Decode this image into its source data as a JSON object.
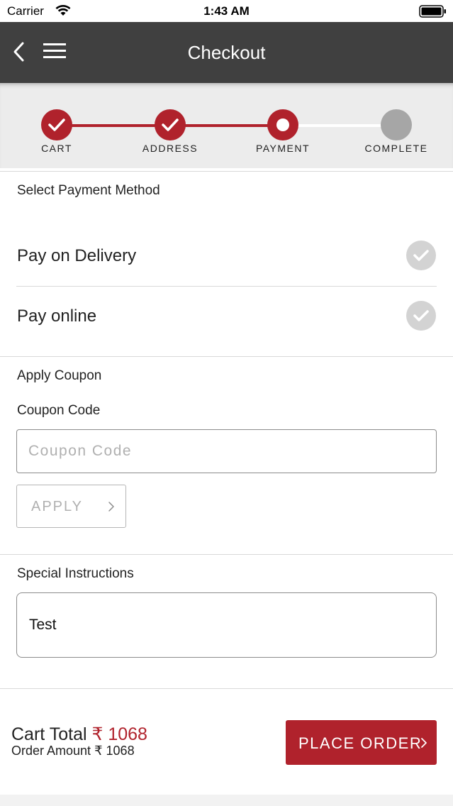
{
  "status_bar": {
    "carrier": "Carrier",
    "time": "1:43 AM",
    "wifi_icon": "wifi-icon",
    "battery_icon": "battery-icon"
  },
  "nav": {
    "title": "Checkout",
    "back_icon": "chevron-left-icon",
    "menu_icon": "hamburger-menu-icon"
  },
  "stepper": {
    "steps": [
      {
        "label": "CART",
        "state": "done"
      },
      {
        "label": "ADDRESS",
        "state": "done"
      },
      {
        "label": "PAYMENT",
        "state": "current"
      },
      {
        "label": "COMPLETE",
        "state": "pending"
      }
    ],
    "colors": {
      "active": "#b0222c",
      "pending": "#a6a6a6",
      "line_pending": "#ffffff"
    }
  },
  "payment": {
    "title": "Select Payment Method",
    "options": [
      {
        "label": "Pay on Delivery",
        "selected": false
      },
      {
        "label": "Pay online",
        "selected": false
      }
    ]
  },
  "coupon": {
    "section_title": "Apply Coupon",
    "field_label": "Coupon Code",
    "input_value": "",
    "input_placeholder": "Coupon Code",
    "apply_label": "APPLY"
  },
  "instructions": {
    "title": "Special Instructions",
    "value": "Test"
  },
  "footer": {
    "cart_total_label": "Cart Total",
    "cart_total_value": "₹ 1068",
    "order_amount_label": "Order Amount",
    "order_amount_value": "₹ 1068",
    "place_order_label": "PLACE ORDER"
  },
  "colors": {
    "brand": "#b0222c",
    "nav_bg": "#404040",
    "stepper_bg": "#ececec"
  }
}
